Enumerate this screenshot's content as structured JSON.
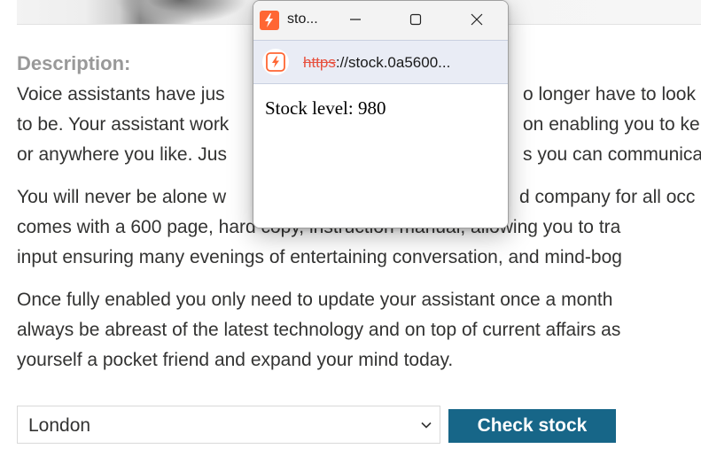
{
  "product": {
    "description_heading": "Description:",
    "paragraphs": [
      [
        "Voice assistants have jus",
        "to be. Your assistant work",
        "or anywhere you like. Jus"
      ],
      [
        "You will never be alone w",
        "comes with a 600 page, hard copy, instruction manual, allowing you to tra",
        "input ensuring many evenings of entertaining conversation, and mind-bog"
      ],
      [
        "Once fully enabled you only need to update your assistant once a month",
        "always be abreast of the latest technology and on top of current affairs as",
        "yourself a pocket friend and expand your mind today."
      ]
    ],
    "paragraph_right_fragments": [
      [
        "o longer have to look",
        "on enabling you to ke",
        "s you can communica"
      ],
      [
        "d company for all occ",
        "",
        ""
      ]
    ]
  },
  "stock_form": {
    "selected_store": "London",
    "button_label": "Check stock"
  },
  "popup": {
    "title": "sto...",
    "url_scheme": "https",
    "url_rest": "://stock.0a5600...",
    "stock_text": "Stock level: 980"
  },
  "colors": {
    "button_bg": "#176688",
    "heading": "#999999",
    "body_text": "#333332",
    "url_scheme": "#e7513f",
    "app_icon": "#ff6633"
  }
}
